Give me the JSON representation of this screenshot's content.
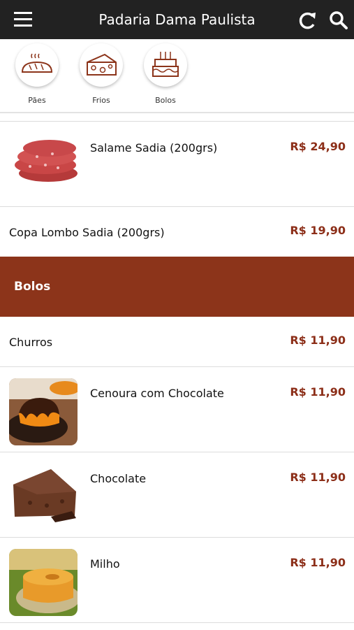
{
  "header": {
    "title": "Padaria Dama Paulista",
    "menu_icon": "hamburger-menu-icon",
    "refresh_icon": "refresh-icon",
    "search_icon": "search-icon"
  },
  "categories": [
    {
      "label": "Pães",
      "icon": "bread-icon"
    },
    {
      "label": "Frios",
      "icon": "cheese-icon"
    },
    {
      "label": "Bolos",
      "icon": "cake-icon"
    }
  ],
  "products_frios": [
    {
      "name": "Salame Sadia (200grs)",
      "price": "R$ 24,90"
    },
    {
      "name": "Copa Lombo Sadia (200grs)",
      "price": "R$ 19,90"
    }
  ],
  "section_bolos": {
    "title": "Bolos"
  },
  "products_bolos": [
    {
      "name": "Churros",
      "price": "R$ 11,90"
    },
    {
      "name": "Cenoura com Chocolate",
      "price": "R$ 11,90"
    },
    {
      "name": "Chocolate",
      "price": "R$ 11,90"
    },
    {
      "name": "Milho",
      "price": "R$ 11,90"
    }
  ],
  "colors": {
    "topbar": "#222222",
    "accent": "#8c341a",
    "price": "#8c2e18"
  }
}
